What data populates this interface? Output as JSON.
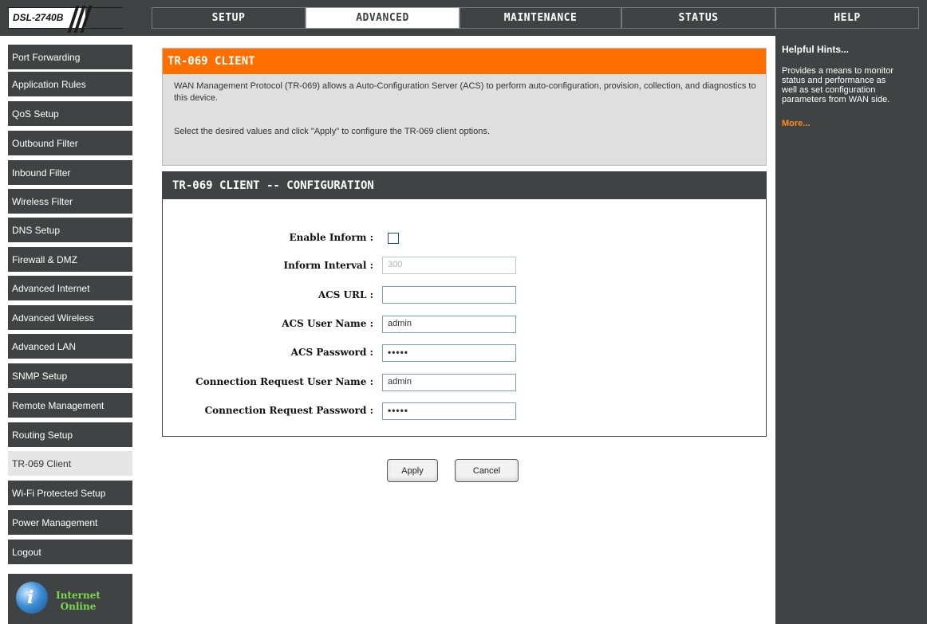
{
  "header": {
    "model": "DSL-2740B",
    "tabs": [
      {
        "label": "SETUP"
      },
      {
        "label": "ADVANCED"
      },
      {
        "label": "MAINTENANCE"
      },
      {
        "label": "STATUS"
      },
      {
        "label": "HELP"
      }
    ]
  },
  "sidebar": {
    "items": [
      {
        "label": "Port Forwarding"
      },
      {
        "label": "Application Rules"
      },
      {
        "label": "QoS Setup"
      },
      {
        "label": "Outbound Filter"
      },
      {
        "label": "Inbound Filter"
      },
      {
        "label": "Wireless Filter"
      },
      {
        "label": "DNS Setup"
      },
      {
        "label": "Firewall & DMZ"
      },
      {
        "label": "Advanced Internet"
      },
      {
        "label": "Advanced Wireless"
      },
      {
        "label": "Advanced LAN"
      },
      {
        "label": "SNMP Setup"
      },
      {
        "label": "Remote Management"
      },
      {
        "label": "Routing Setup"
      },
      {
        "label": "TR-069 Client"
      },
      {
        "label": "Wi-Fi Protected Setup"
      },
      {
        "label": "Power Management"
      },
      {
        "label": "Logout"
      }
    ],
    "active_item": "TR-069 Client",
    "internet_status": {
      "line1": "Internet",
      "line2": "Online"
    }
  },
  "intro": {
    "title": "TR-069 CLIENT",
    "description": "WAN Management Protocol (TR-069) allows a Auto-Configuration Server (ACS) to perform auto-configuration, provision, collection, and diagnostics to this device.",
    "instruction": "Select the desired values and click \"Apply\" to configure the TR-069 client options."
  },
  "config": {
    "title": "TR-069 CLIENT -- CONFIGURATION",
    "fields": {
      "enable_inform": {
        "label": "Enable Inform :",
        "checked": false
      },
      "inform_interval": {
        "label": "Inform Interval :",
        "value": "300"
      },
      "acs_url": {
        "label": "ACS URL :",
        "value": ""
      },
      "acs_user_name": {
        "label": "ACS User Name :",
        "value": "admin"
      },
      "acs_password": {
        "label": "ACS Password :",
        "value": "•••••"
      },
      "conn_req_user_name": {
        "label": "Connection Request User Name :",
        "value": "admin"
      },
      "conn_req_password": {
        "label": "Connection Request Password :",
        "value": "•••••"
      }
    }
  },
  "buttons": {
    "apply": "Apply",
    "cancel": "Cancel"
  },
  "help": {
    "title": "Helpful Hints...",
    "text": "Provides a means to monitor status and performance as well as set configuration parameters from WAN side.",
    "more": "More..."
  },
  "colors": {
    "dark_gray": "#404343",
    "accent_orange": "#ff6f00",
    "status_green": "#7cd94e",
    "more_link": "#ff8c1a"
  }
}
